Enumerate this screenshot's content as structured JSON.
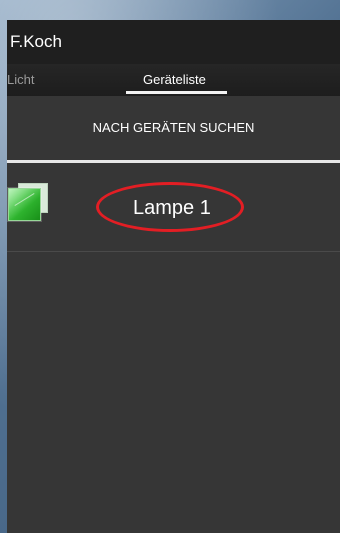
{
  "app": {
    "title": "F.Koch"
  },
  "tabs": [
    {
      "label": "Licht"
    },
    {
      "label": "Geräteliste"
    }
  ],
  "actions": {
    "search_button_label": "NACH GERÄTEN SUCHEN"
  },
  "devices": [
    {
      "name": "Lampe 1",
      "icon": "device-cube-icon"
    }
  ],
  "colors": {
    "screen_background": "#363636",
    "action_bar_background": "#1f1f1f",
    "text_primary": "#ffffff",
    "text_secondary": "#9a9a9a",
    "annotation_ellipse": "#e31e24",
    "device_icon_green": "#2fb52f"
  }
}
